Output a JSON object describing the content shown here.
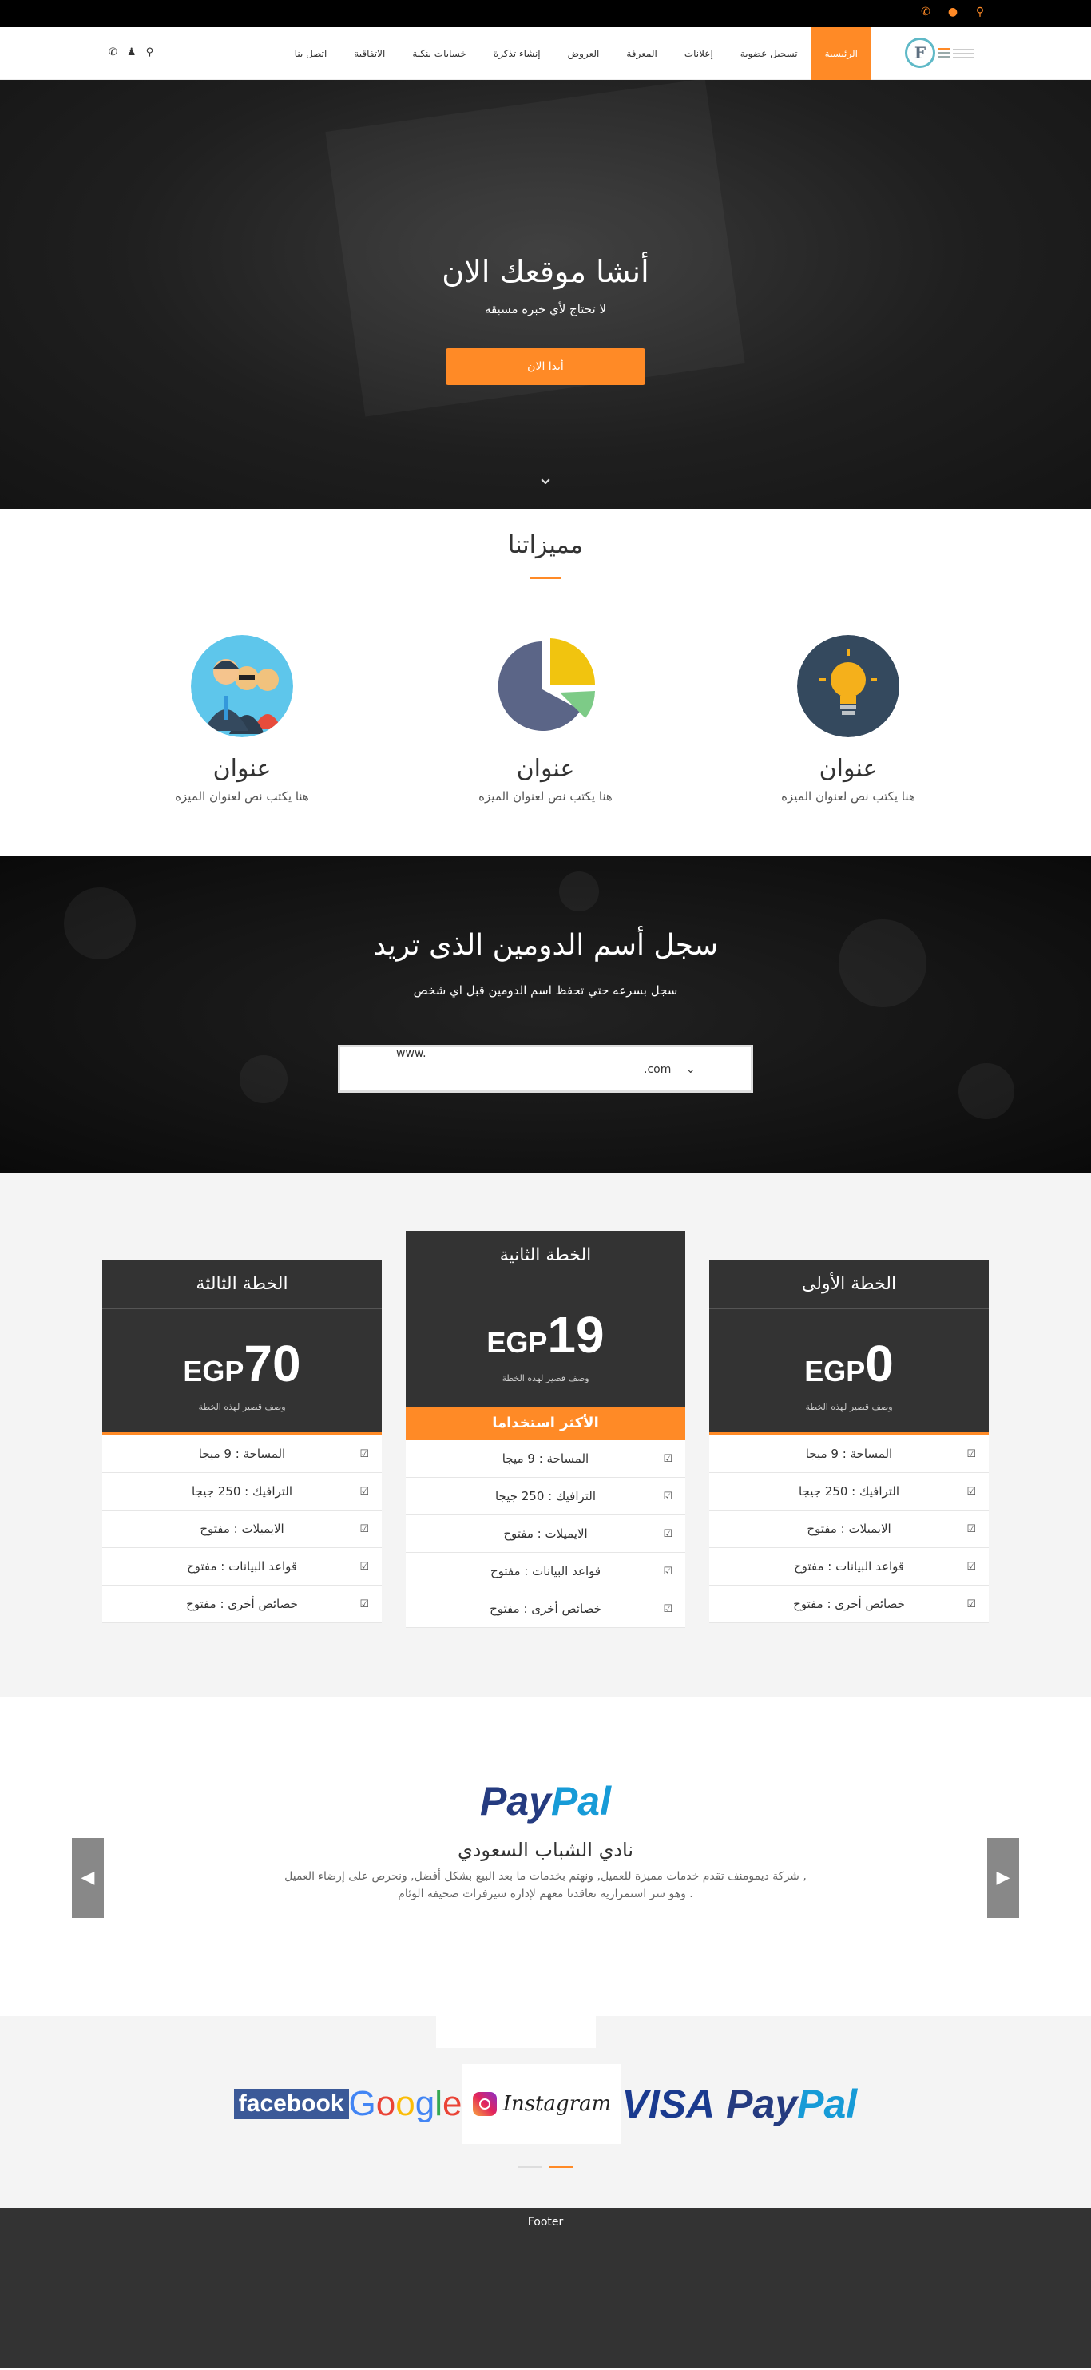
{
  "nav": {
    "items": [
      {
        "label": "الرئيسية",
        "active": true
      },
      {
        "label": "تسجيل عضوية",
        "active": false
      },
      {
        "label": "إعلانات",
        "active": false
      },
      {
        "label": "المعرفة",
        "active": false
      },
      {
        "label": "العروض",
        "active": false
      },
      {
        "label": "إنشاء تذكرة",
        "active": false
      },
      {
        "label": "خسابات بنكية",
        "active": false
      },
      {
        "label": "الاتفاقية",
        "active": false
      },
      {
        "label": "اتصل بنا",
        "active": false
      }
    ],
    "logo_letter": "F"
  },
  "hero": {
    "title": "أنشا موقعك الان",
    "subtitle": "لا تحتاج لأي خبره مسبقه",
    "button": "أبدا الان"
  },
  "features": {
    "title": "مميزاتنا",
    "items": [
      {
        "title": "عنوان",
        "desc": "هنا يكتب نص لعنوان الميزه",
        "icon": "lightbulb-icon"
      },
      {
        "title": "عنوان",
        "desc": "هنا يكتب نص لعنوان الميزه",
        "icon": "pie-chart-icon"
      },
      {
        "title": "عنوان",
        "desc": "هنا يكتب نص لعنوان الميزه",
        "icon": "team-icon"
      }
    ]
  },
  "domain": {
    "title": "سجل أسم الدومين الذى تريد",
    "subtitle": "سجل بسرعه حتي تحفظ اسم الدومين قبل اي شخص",
    "placeholder": "www.",
    "tld": ".com"
  },
  "pricing": {
    "currency": "EGP",
    "desc": "وصف قصير لهذه الخطة",
    "popular_label": "الأكثر استخداما",
    "plans": [
      {
        "name": "الخطة الأولى",
        "price": "0"
      },
      {
        "name": "الخطة الثانية",
        "price": "19"
      },
      {
        "name": "الخطة الثالثة",
        "price": "70"
      }
    ],
    "features": [
      "المساحة : 9 ميجا",
      "الترافيك : 250 جيجا",
      "الايميلات : مفتوح",
      "قواعد البيانات : مفتوح",
      "خصائص أخرى : مفتوح"
    ]
  },
  "testimonial": {
    "logo_text_1": "Pay",
    "logo_text_2": "Pal",
    "name": "نادي الشباب السعودي",
    "line1": "شركة ديمومنف تقدم خدمات مميزة للعميل, ونهتم بخدمات ما بعد البيع بشكل أفضل, ونحرص على إرضاء العميل ,",
    "line2": "وهو سر استمرارية تعاقدنا معهم لإدارة سيرفرات صحيفة الوئام ."
  },
  "clients": {
    "facebook": "facebook",
    "google": [
      "G",
      "o",
      "o",
      "g",
      "l",
      "e"
    ],
    "instagram": "Instagram",
    "visa": "VISA",
    "paypal_1": "Pay",
    "paypal_2": "Pal"
  },
  "footer": {
    "text": "Footer"
  },
  "colors": {
    "accent": "#ff8a26",
    "dark": "#333333",
    "paypal_dark": "#253b80",
    "paypal_light": "#179bd7"
  }
}
